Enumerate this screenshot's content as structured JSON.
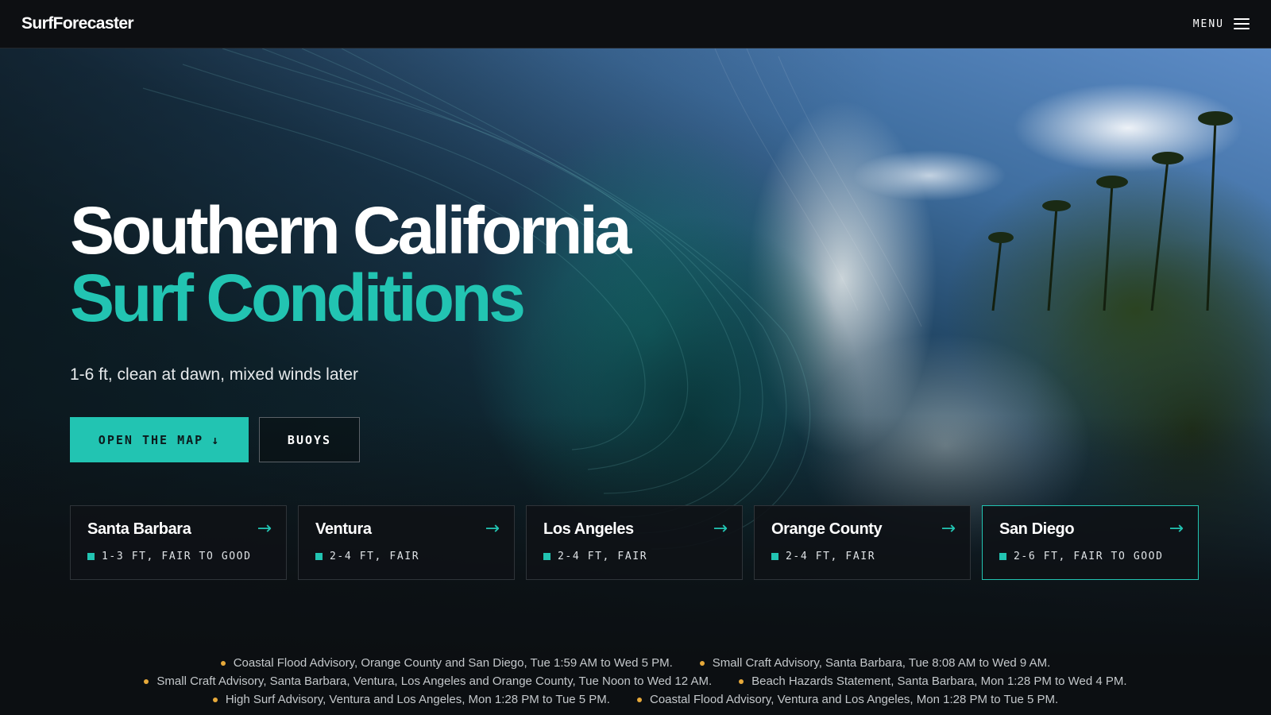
{
  "header": {
    "logo": "SurfForecaster",
    "menu_label": "MENU"
  },
  "hero": {
    "title_line1": "Southern California",
    "title_line2": "Surf Conditions",
    "subtitle": "1-6 ft, clean at dawn, mixed winds later",
    "primary_button": "OPEN THE MAP",
    "secondary_button": "BUOYS"
  },
  "regions": [
    {
      "name": "Santa Barbara",
      "status": "1-3 FT, FAIR TO GOOD"
    },
    {
      "name": "Ventura",
      "status": "2-4 FT, FAIR"
    },
    {
      "name": "Los Angeles",
      "status": "2-4 FT, FAIR"
    },
    {
      "name": "Orange County",
      "status": "2-4 FT, FAIR"
    },
    {
      "name": "San Diego",
      "status": "2-6 FT, FAIR TO GOOD"
    }
  ],
  "advisories": [
    "Coastal Flood Advisory, Orange County and San Diego, Tue 1:59 AM to Wed 5 PM.",
    "Small Craft Advisory, Santa Barbara, Tue 8:08 AM to Wed 9 AM.",
    "Small Craft Advisory, Santa Barbara, Ventura, Los Angeles and Orange County, Tue Noon to Wed 12 AM.",
    "Beach Hazards Statement, Santa Barbara, Mon 1:28 PM to Wed 4 PM.",
    "High Surf Advisory, Ventura and Los Angeles, Mon 1:28 PM to Tue 5 PM.",
    "Coastal Flood Advisory, Ventura and Los Angeles, Mon 1:28 PM to Tue 5 PM."
  ],
  "colors": {
    "accent": "#22c4b2",
    "advisory_dot": "#e7a93a",
    "background": "#0c0f12"
  },
  "icons": {
    "menu": "hamburger-icon",
    "button": "arrow-down-icon",
    "card": "arrow-right-icon"
  },
  "active_region": "San Diego"
}
